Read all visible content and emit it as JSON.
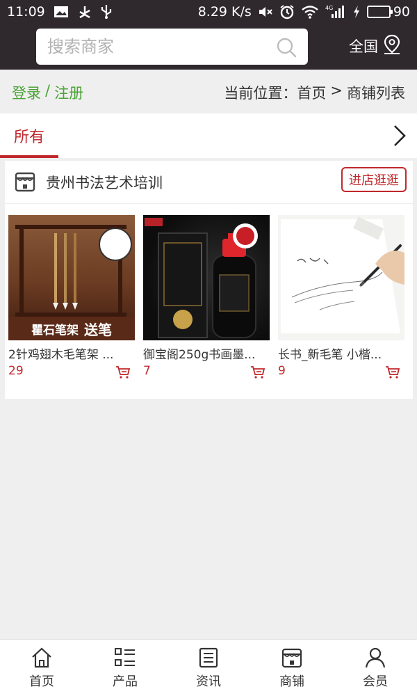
{
  "status_bar": {
    "time": "11:09",
    "net_speed": "8.29 K/s",
    "battery": "90",
    "battery_level": 0.9,
    "icons": [
      "image-notification-icon",
      "usb-icon",
      "android-debug-icon",
      "mute-icon",
      "alarm-icon",
      "wifi-icon",
      "signal-4g-icon",
      "charging-icon",
      "battery-icon"
    ]
  },
  "header": {
    "search_placeholder": "搜索商家",
    "region_label": "全国"
  },
  "breadcrumb": {
    "login": "登录",
    "separator": "/",
    "register": "注册",
    "location_prefix": "当前位置：",
    "home": "首页",
    "arrow": ">",
    "current": "商铺列表"
  },
  "tabs": {
    "active_label": "所有"
  },
  "shop": {
    "name": "贵州书法艺术培训",
    "visit_label": "进店逛逛",
    "products": [
      {
        "name": "2针鸡翅木毛笔架 ...",
        "price": "29",
        "badge_text": [
          "瞿石笔架",
          "送笔"
        ]
      },
      {
        "name": "御宝阁250g书画墨...",
        "price": "7",
        "badge_text": []
      },
      {
        "name": "长书_新毛笔 小楷...",
        "price": "9",
        "badge_text": []
      }
    ]
  },
  "bottom_nav": [
    {
      "label": "首页",
      "icon": "home-icon"
    },
    {
      "label": "产品",
      "icon": "list-icon"
    },
    {
      "label": "资讯",
      "icon": "news-icon"
    },
    {
      "label": "商铺",
      "icon": "store-icon"
    },
    {
      "label": "会员",
      "icon": "user-icon"
    }
  ],
  "colors": {
    "header_bg": "#2f282c",
    "accent_red": "#c0282c",
    "login_green": "#4aa336",
    "page_bg": "#f0efef"
  }
}
